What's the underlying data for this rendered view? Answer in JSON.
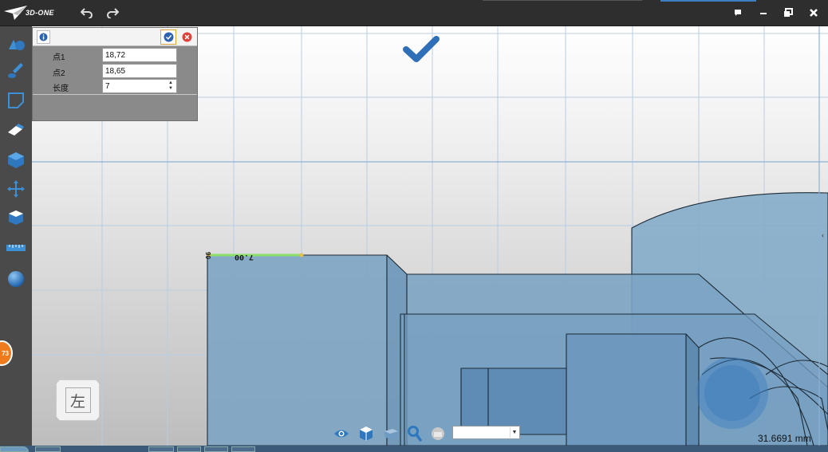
{
  "app": {
    "logo_text": "3D-ONE"
  },
  "titlebar": {
    "undo_icon": "undo-icon",
    "redo_icon": "redo-icon",
    "window_controls": [
      "chat-icon",
      "minimize-icon",
      "restore-icon",
      "close-icon"
    ]
  },
  "left_toolbar": {
    "tools": [
      "basic-solid-icon",
      "paint-brush-icon",
      "sketch-icon",
      "eraser-icon",
      "solid-box-icon",
      "move-icon",
      "combine-icon",
      "measure-ruler-icon",
      "sphere-icon"
    ]
  },
  "panel": {
    "rows": [
      {
        "label": "点1",
        "value": "18,72"
      },
      {
        "label": "点2",
        "value": "18,65"
      },
      {
        "label": "长度",
        "value": "7"
      }
    ]
  },
  "badge": {
    "text": "73"
  },
  "viewcube": {
    "face": "左"
  },
  "dimension": {
    "length_label": "7.00",
    "side_label": "90"
  },
  "bottom_toolbar": {
    "icons": [
      "eye-icon",
      "view-cube-icon",
      "box-face-icon",
      "zoom-icon",
      "render-icon"
    ],
    "view_select": ""
  },
  "status": {
    "measurement": "31.6691 mm"
  },
  "colors": {
    "accent": "#2f6fb8",
    "solid_fill": "#7fa6c4",
    "titlebar": "#2e2e2e",
    "toolbar": "#4a4a4a",
    "highlight_green": "#8be06a",
    "badge_orange": "#f07b1c"
  }
}
